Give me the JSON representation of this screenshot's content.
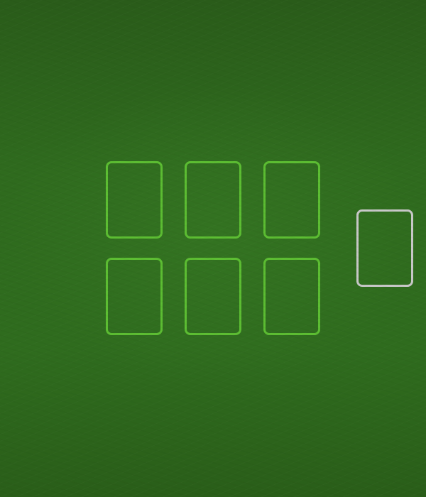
{
  "table": {
    "felt_color": "#2f6b1e",
    "slot_outline_color": "#5cbd32",
    "deck_outline_color": "#c8c8c8"
  },
  "tableau": {
    "rows": 2,
    "columns": 3,
    "slots": [
      {
        "id": 1,
        "state": "empty"
      },
      {
        "id": 2,
        "state": "empty"
      },
      {
        "id": 3,
        "state": "empty"
      },
      {
        "id": 4,
        "state": "empty"
      },
      {
        "id": 5,
        "state": "empty"
      },
      {
        "id": 6,
        "state": "empty"
      }
    ]
  },
  "deck": {
    "state": "empty"
  }
}
